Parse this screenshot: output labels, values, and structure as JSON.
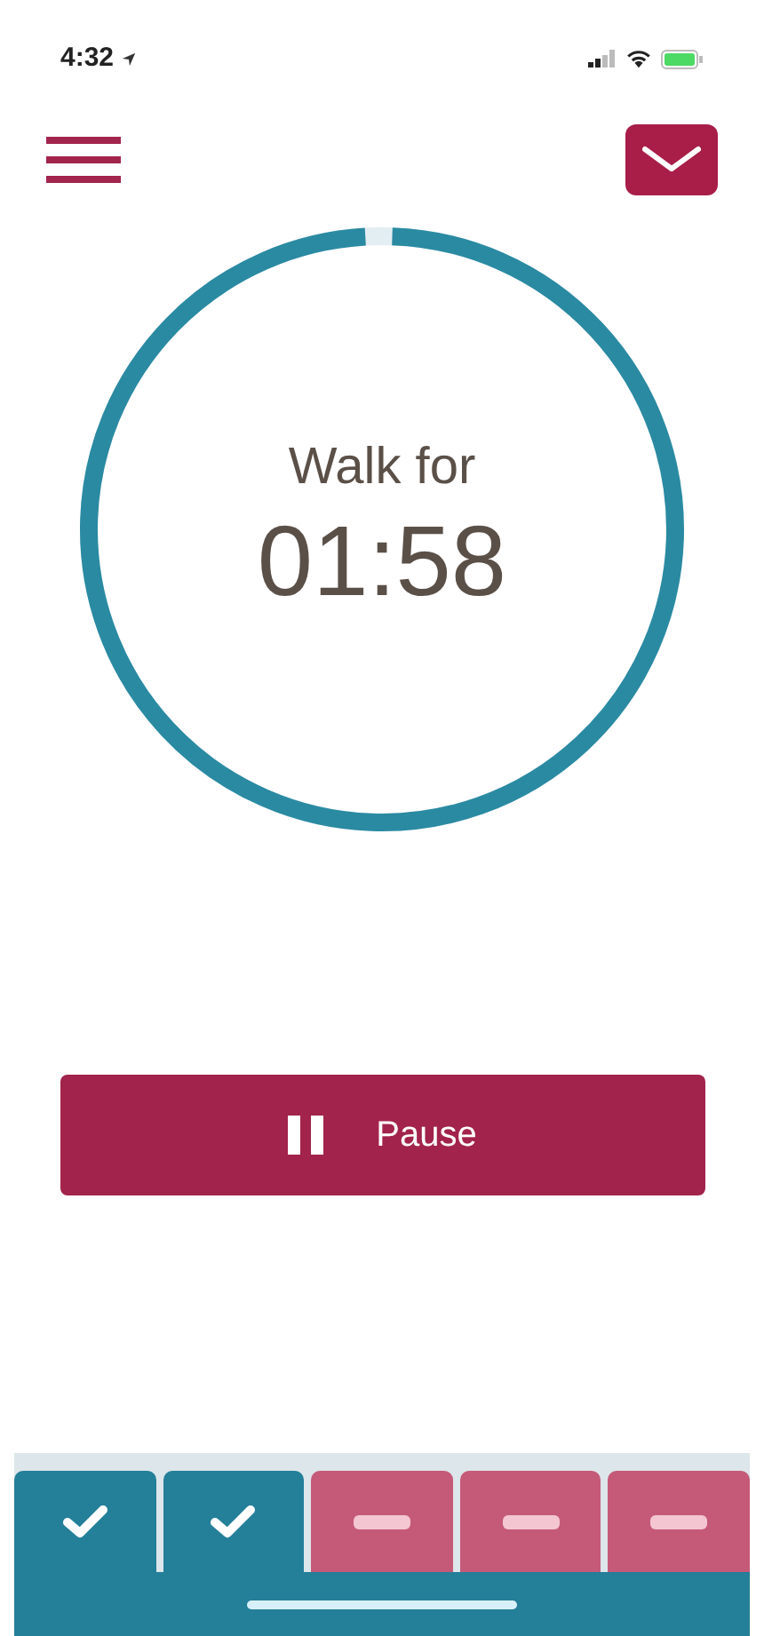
{
  "status_bar": {
    "time": "4:32"
  },
  "timer": {
    "label": "Walk for",
    "time": "01:58",
    "level": 0.985
  },
  "pause_button": {
    "label": "Pause"
  },
  "steps": [
    {
      "done": true
    },
    {
      "done": true
    },
    {
      "done": false
    },
    {
      "done": false
    },
    {
      "done": false
    }
  ]
}
